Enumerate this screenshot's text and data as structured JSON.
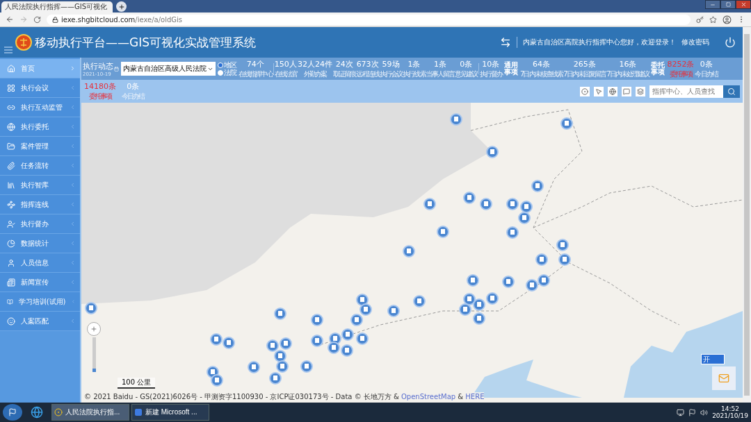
{
  "browser": {
    "tab_title": "人民法院执行指挥——GIS可视化",
    "url_host": "iexe.shgbitcloud.com",
    "url_path": "/iexe/a/oldGis"
  },
  "header": {
    "title": "移动执行平台——GIS可视化实战管理系统",
    "welcome": "内蒙古自治区高院执行指挥中心您好，欢迎登录！",
    "change_password": "修改密码"
  },
  "sidebar": {
    "items": [
      {
        "label": "首页",
        "selected": true
      },
      {
        "label": "执行会议",
        "selected": false
      },
      {
        "label": "执行互动监管",
        "selected": false
      },
      {
        "label": "执行委托",
        "selected": false
      },
      {
        "label": "案件管理",
        "selected": false
      },
      {
        "label": "任务流转",
        "selected": false
      },
      {
        "label": "执行智库",
        "selected": false
      },
      {
        "label": "指挥连线",
        "selected": false
      },
      {
        "label": "执行督办",
        "selected": false
      },
      {
        "label": "数据统计",
        "selected": false
      },
      {
        "label": "人员信息",
        "selected": false
      },
      {
        "label": "新闻宣传",
        "selected": false
      },
      {
        "label": "学习培训(试用)",
        "selected": false
      },
      {
        "label": "人案匹配",
        "selected": false
      }
    ]
  },
  "dynamics": {
    "title": "执行动态",
    "date": "2021-10-19",
    "court": "内蒙古自治区高级人民法院",
    "scope": [
      {
        "label": "地区",
        "selected": true
      },
      {
        "label": "法院",
        "selected": false
      }
    ]
  },
  "stats": [
    {
      "kind": "stat",
      "value": "74个",
      "label": "在线指挥中心",
      "alert": false
    },
    {
      "kind": "divider"
    },
    {
      "kind": "stat",
      "value": "150人",
      "label": "在线法官",
      "alert": false
    },
    {
      "kind": "stat",
      "value": "32人24件",
      "label": "外勤办案",
      "alert": false
    },
    {
      "kind": "stat",
      "value": "24次",
      "label": "取证留痕",
      "alert": false
    },
    {
      "kind": "stat",
      "value": "673次",
      "label": "远程连线",
      "alert": false
    },
    {
      "kind": "stat",
      "value": "59场",
      "label": "执行会议",
      "alert": false
    },
    {
      "kind": "stat",
      "value": "1条",
      "label": "执行线索",
      "alert": false
    },
    {
      "kind": "stat",
      "value": "1条",
      "label": "当事人留言",
      "alert": false
    },
    {
      "kind": "stat",
      "value": "0条",
      "label": "意见建议",
      "alert": false
    },
    {
      "kind": "divider"
    },
    {
      "kind": "stat",
      "value": "10条",
      "label": "执行督办",
      "alert": false
    },
    {
      "kind": "group",
      "label": "通用事项",
      "items": [
        {
          "value": "64条",
          "label": "7日内未核查线索",
          "alert": false
        },
        {
          "value": "265条",
          "label": "7日内未回复留言",
          "alert": false
        },
        {
          "value": "16条",
          "label": "7日内未处理建议",
          "alert": false
        }
      ]
    },
    {
      "kind": "group",
      "label": "委托事项",
      "items": [
        {
          "value": "8252条",
          "label": "委托事项",
          "alert": true
        },
        {
          "value": "0条",
          "label": "今日办结",
          "alert": false
        }
      ]
    }
  ],
  "stats_row2": [
    {
      "value": "14180条",
      "label": "委托事项",
      "alert": true
    },
    {
      "value": "0条",
      "label": "今日办结",
      "alert": false
    }
  ],
  "map": {
    "search_placeholder": "指挥中心、人员查找",
    "scale": "100 公里",
    "attribution": "© 2021 Baidu - GS(2021)6026号 - 甲测资字1100930 - 京ICP证030173号 - Data © 长地万方 & ",
    "osm": "OpenStreetMap",
    "amp": " & ",
    "here": "HERE",
    "toggle": "开",
    "zoom": {
      "level": 0.1
    }
  },
  "taskbar": {
    "tasks": [
      {
        "kind": "chrome",
        "label": "人民法院执行指...",
        "selected": true
      },
      {
        "kind": "word",
        "label": "新建 Microsoft ...",
        "selected": false
      }
    ],
    "time": "14:52",
    "date": "2021/10/19"
  }
}
